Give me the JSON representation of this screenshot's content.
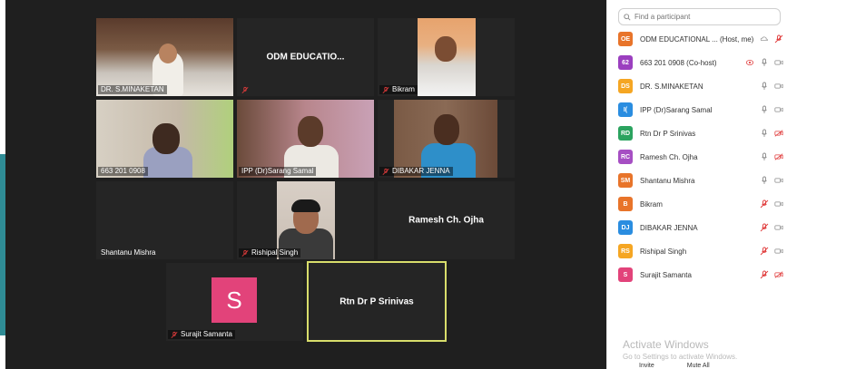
{
  "tiles": [
    {
      "name": "DR. S.MINAKETAN",
      "big": "",
      "muted": false
    },
    {
      "name": "",
      "big": "ODM EDUCATIO...",
      "muted": true
    },
    {
      "name": "Bikram",
      "big": "",
      "muted": true
    },
    {
      "name": "663 201 0908",
      "big": "",
      "muted": false
    },
    {
      "name": "IPP  (Dr)Sarang Samal",
      "big": "",
      "muted": false
    },
    {
      "name": "DIBAKAR JENNA",
      "big": "",
      "muted": true
    },
    {
      "name": "Shantanu Mishra",
      "big": "",
      "muted": false
    },
    {
      "name": "Rishipal Singh",
      "big": "",
      "muted": true
    },
    {
      "name": "",
      "big": "Ramesh Ch. Ojha",
      "muted": false
    },
    {
      "name": "Surajit Samanta",
      "big": "",
      "muted": true,
      "avatar": "S"
    },
    {
      "name": "",
      "big": "Rtn Dr P Srinivas",
      "muted": false,
      "active": true
    }
  ],
  "panel": {
    "search_placeholder": "Find a participant",
    "participants": [
      {
        "initials": "OE",
        "name": "ODM EDUCATIONAL ... (Host, me)",
        "color": "#e8742a",
        "mic": "muted",
        "video": "none",
        "share": true
      },
      {
        "initials": "62",
        "name": "663 201 0908 (Co-host)",
        "color": "#9b3fbf",
        "mic": "on",
        "video": "on",
        "rec": true
      },
      {
        "initials": "DS",
        "name": "DR. S.MINAKETAN",
        "color": "#f5a623",
        "mic": "on",
        "video": "on"
      },
      {
        "initials": "I(",
        "name": "IPP  (Dr)Sarang Samal",
        "color": "#2a8de0",
        "mic": "on",
        "video": "on"
      },
      {
        "initials": "RD",
        "name": "Rtn Dr P Srinivas",
        "color": "#2ba35f",
        "mic": "on",
        "video": "off"
      },
      {
        "initials": "RC",
        "name": "Ramesh Ch. Ojha",
        "color": "#a64fc3",
        "mic": "on",
        "video": "off"
      },
      {
        "initials": "SM",
        "name": "Shantanu Mishra",
        "color": "#e8742a",
        "mic": "on",
        "video": "on"
      },
      {
        "initials": "B",
        "name": "Bikram",
        "color": "#e8742a",
        "mic": "muted",
        "video": "on"
      },
      {
        "initials": "DJ",
        "name": "DIBAKAR JENNA",
        "color": "#2a8de0",
        "mic": "muted",
        "video": "on"
      },
      {
        "initials": "RS",
        "name": "Rishipal Singh",
        "color": "#f5a623",
        "mic": "muted",
        "video": "on"
      },
      {
        "initials": "S",
        "name": "Surajit Samanta",
        "color": "#e2437a",
        "mic": "muted",
        "video": "off"
      }
    ],
    "activate_title": "Activate Windows",
    "activate_sub": "Go to Settings to activate Windows.",
    "invite_label": "Invite",
    "mute_all_label": "Mute All"
  }
}
